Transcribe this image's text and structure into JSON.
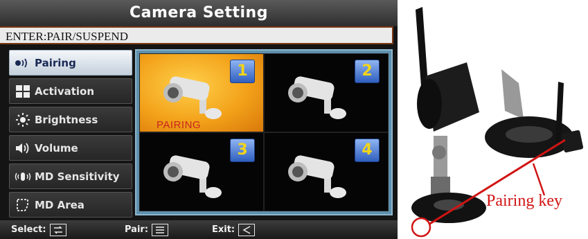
{
  "screen": {
    "title": "Camera Setting",
    "instruction": "ENTER:PAIR/SUSPEND",
    "menu": [
      {
        "label": "Pairing",
        "icon": "pairing-signal-icon",
        "active": true
      },
      {
        "label": "Activation",
        "icon": "activation-grid-icon",
        "active": false
      },
      {
        "label": "Brightness",
        "icon": "brightness-sun-icon",
        "active": false
      },
      {
        "label": "Volume",
        "icon": "volume-speaker-icon",
        "active": false
      },
      {
        "label": "MD Sensitivity",
        "icon": "hand-waves-icon",
        "active": false
      },
      {
        "label": "MD Area",
        "icon": "area-outline-icon",
        "active": false
      }
    ],
    "cameras": [
      {
        "number": "1",
        "status": "PAIRING",
        "selected": true
      },
      {
        "number": "2",
        "selected": false
      },
      {
        "number": "3",
        "selected": false
      },
      {
        "number": "4",
        "selected": false
      }
    ],
    "footer": {
      "select_label": "Select:",
      "pair_label": "Pair:",
      "exit_label": "Exit:"
    }
  },
  "photo": {
    "callout_label": "Pairing key"
  },
  "colors": {
    "selected_cell": "#f3a21a",
    "badge_blue": "#2f5fbf",
    "badge_text": "#f2d41a",
    "callout_red": "#d11414",
    "grid_border": "#5f90ad"
  }
}
